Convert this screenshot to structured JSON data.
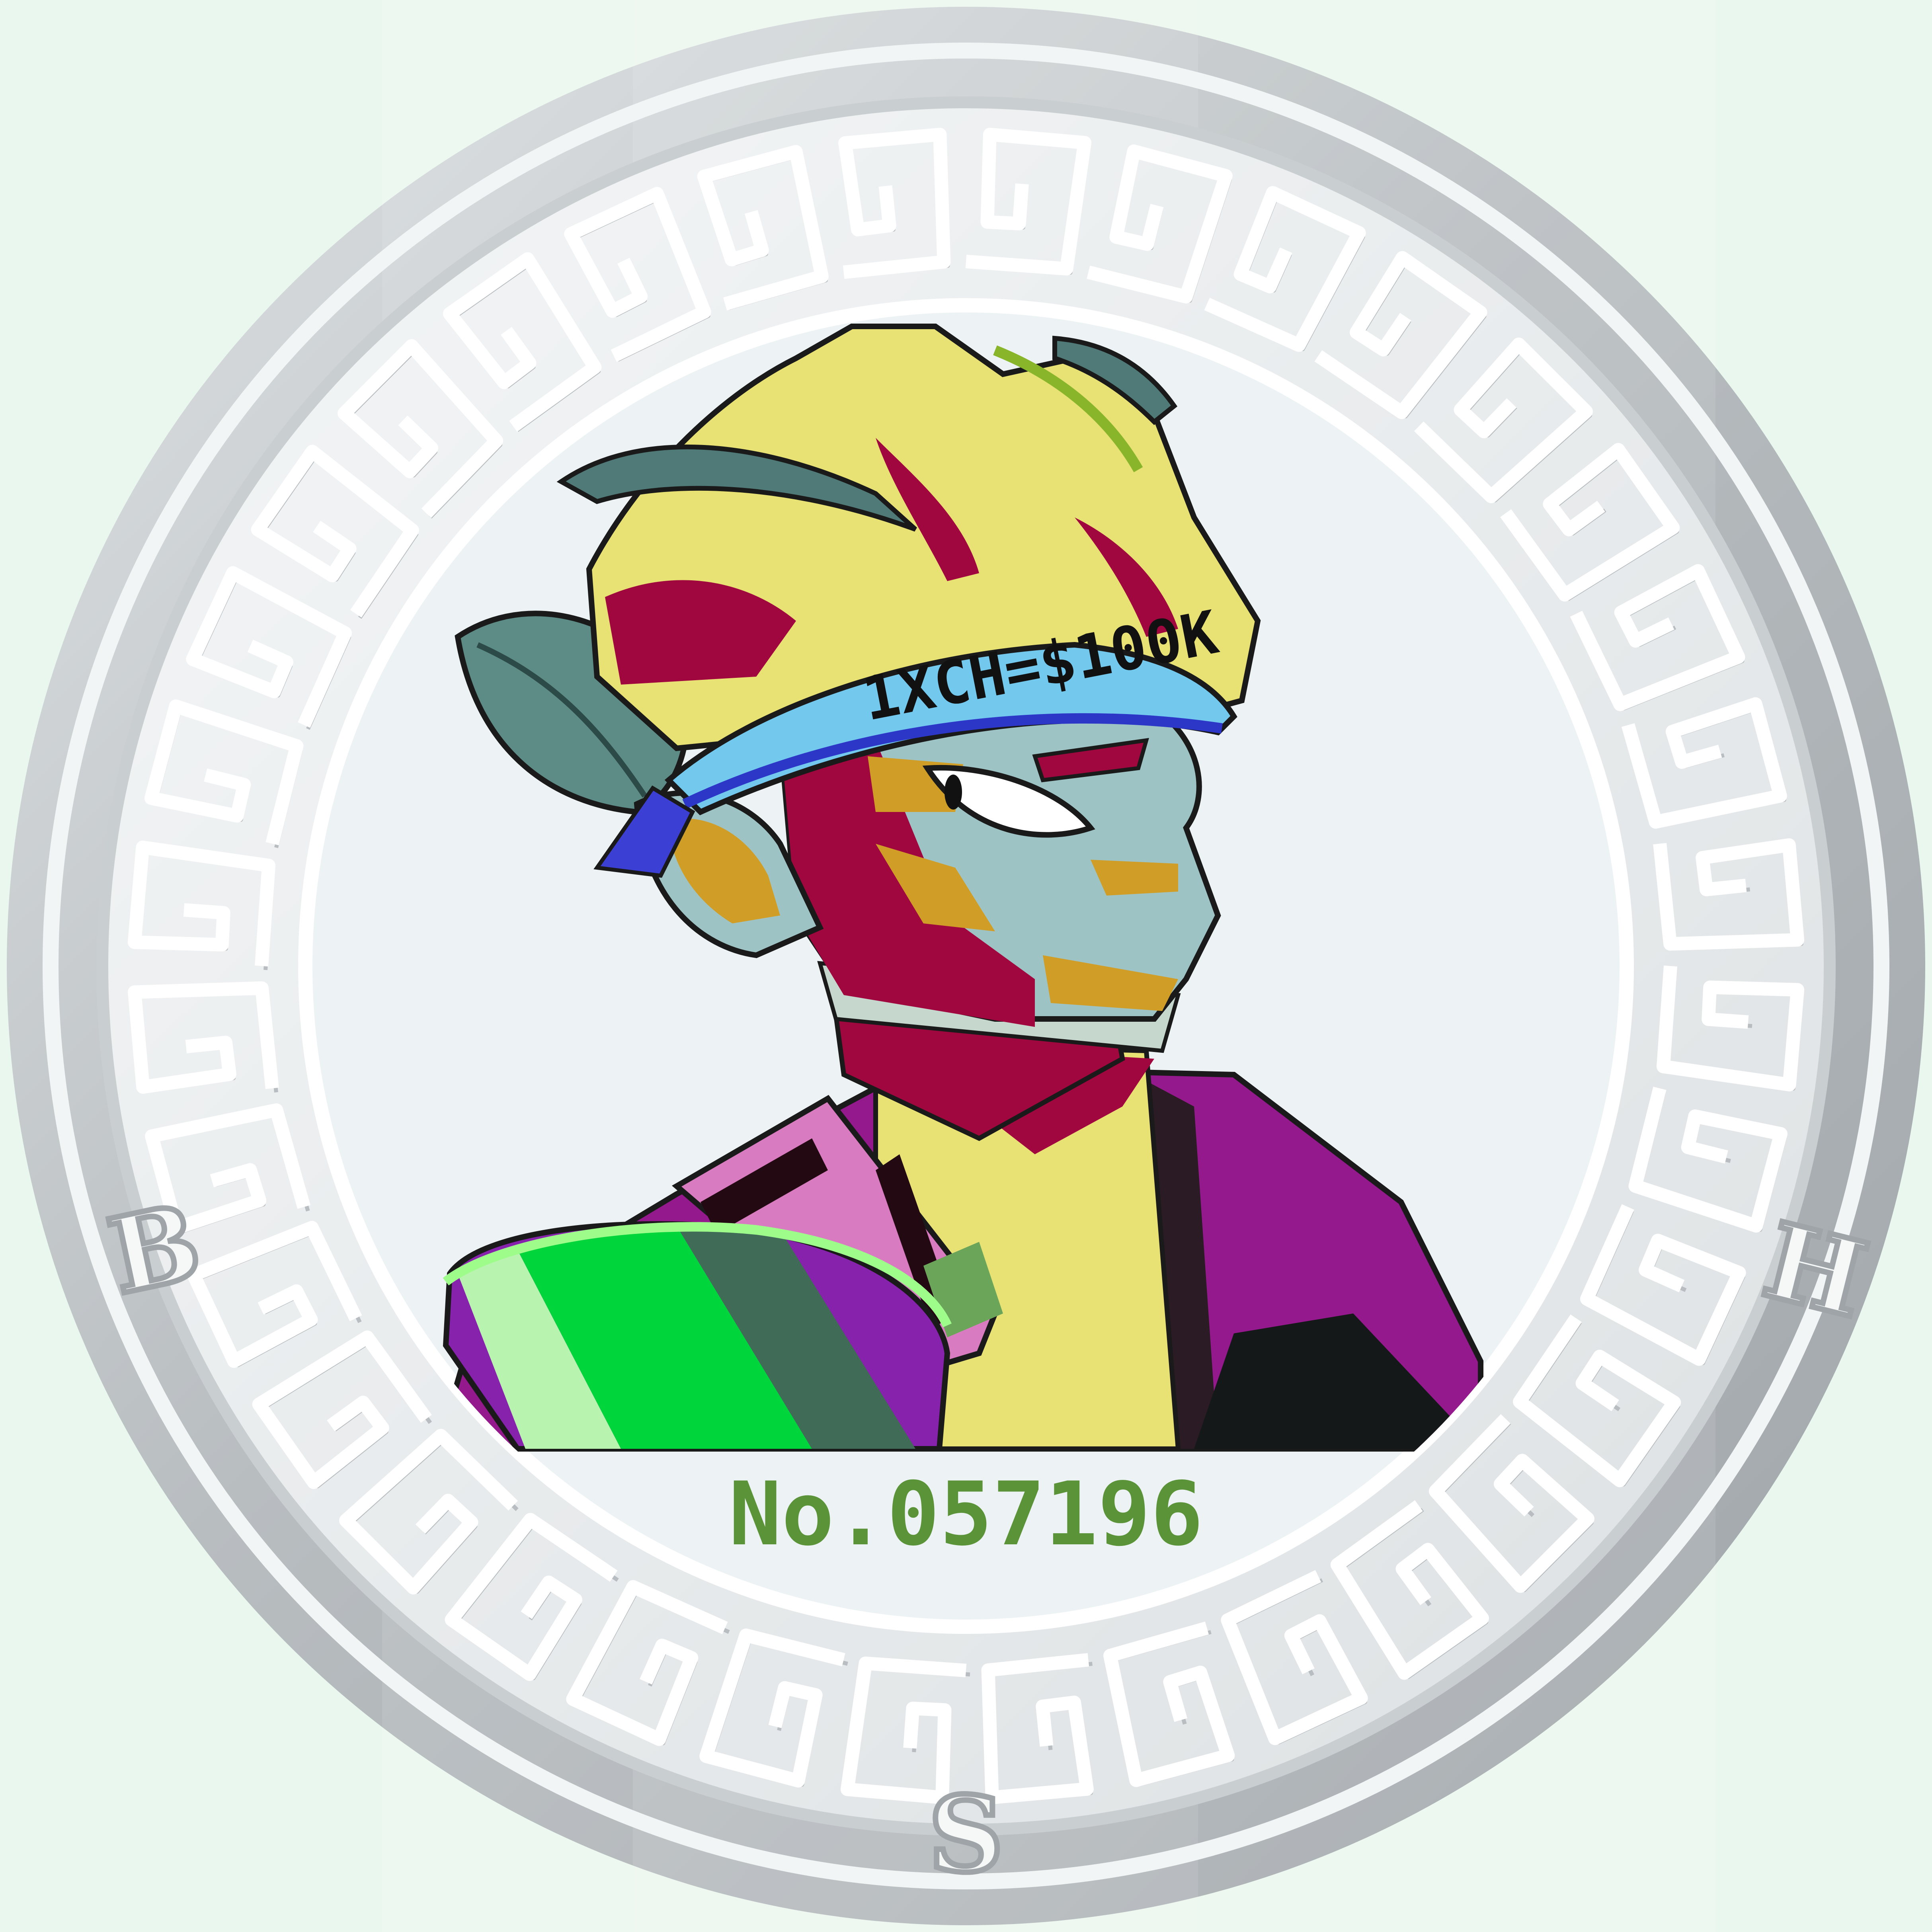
{
  "coin": {
    "serial": "No.057196",
    "letter_left": "B",
    "letter_right": "H",
    "letter_bottom": "S"
  },
  "character": {
    "headband_text": "1XCH=$100K"
  },
  "colors": {
    "background": "#eaf7ee",
    "serial": "#5b9338",
    "silver_light": "#f2f5f6",
    "silver_mid": "#c9ced1",
    "silver_dark": "#8f9599",
    "hair": "#e8e173",
    "hair_shadow": "#a0073f",
    "skin": "#9ec3c4",
    "headband": "#73c8ee",
    "shirt": "#e8e173",
    "jacket": "#94198c",
    "ball_green": "#00d63c",
    "ball_purple": "#8622ac"
  }
}
